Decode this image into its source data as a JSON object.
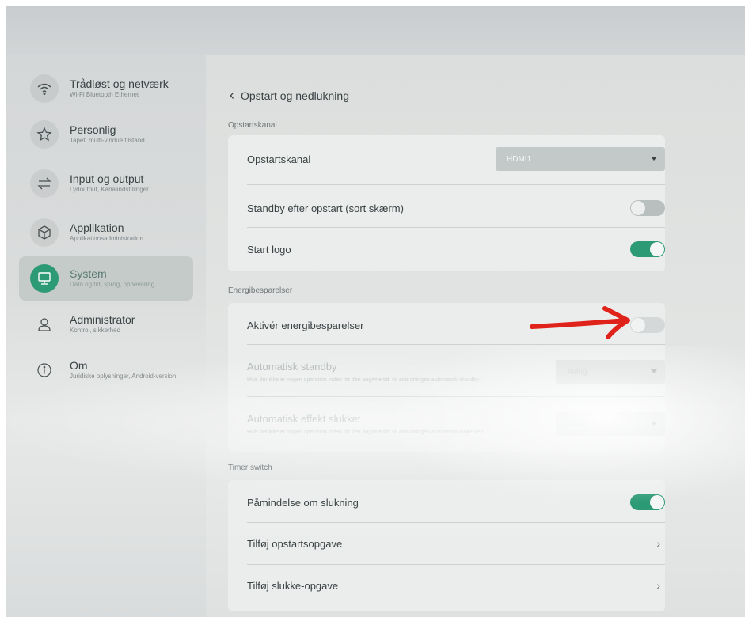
{
  "sidebar": {
    "items": [
      {
        "title": "Trådløst og netværk",
        "sub": "Wi-Fi Bluetooth Ethernet",
        "icon": "wifi-icon"
      },
      {
        "title": "Personlig",
        "sub": "Tapet, multi-vindue tilstand",
        "icon": "star-icon"
      },
      {
        "title": "Input og output",
        "sub": "Lydoutput, Kanalindstillinger",
        "icon": "swap-arrows-icon"
      },
      {
        "title": "Applikation",
        "sub": "Applikationsadministration",
        "icon": "cube-icon"
      },
      {
        "title": "System",
        "sub": "Dato og tid, sprog, opbevaring",
        "icon": "monitor-icon",
        "active": true
      },
      {
        "title": "Administrator",
        "sub": "Kontrol, sikkerhed",
        "icon": "user-icon"
      },
      {
        "title": "Om",
        "sub": "Juridiske oplysninger, Android-version",
        "icon": "info-icon"
      }
    ]
  },
  "header": {
    "back_icon": "chevron-left-icon",
    "title": "Opstart og nedlukning"
  },
  "sections": {
    "startup": {
      "label": "Opstartskanal",
      "channel": {
        "label": "Opstartskanal",
        "value": "HDMI1"
      },
      "standby": {
        "label": "Standby efter opstart (sort skærm)",
        "on": false
      },
      "logo": {
        "label": "Start logo",
        "on": true
      }
    },
    "energy": {
      "label": "Energibesparelser",
      "enable": {
        "label": "Aktivér energibesparelser",
        "on": false
      },
      "auto_standby": {
        "label": "Automatisk standby",
        "desc": "Hvis der ikke er nogen operation inden for den angivne tid, vil anordningen automatisk standby",
        "value": "Aldrig"
      },
      "auto_off": {
        "label": "Automatisk effekt slukket",
        "desc": "Hvis der ikke er nogen operation inden for den angivne tid, vil anordningen automatisk lukke ned",
        "value": "Aldrig"
      }
    },
    "timer": {
      "label": "Timer switch",
      "reminder": {
        "label": "Påmindelse om slukning",
        "on": true
      },
      "add_startup": {
        "label": "Tilføj opstartsopgave"
      },
      "add_shutdown": {
        "label": "Tilføj slukke-opgave"
      }
    }
  },
  "colors": {
    "accent": "#2d9a76",
    "annotation_arrow": "#e0231a"
  }
}
